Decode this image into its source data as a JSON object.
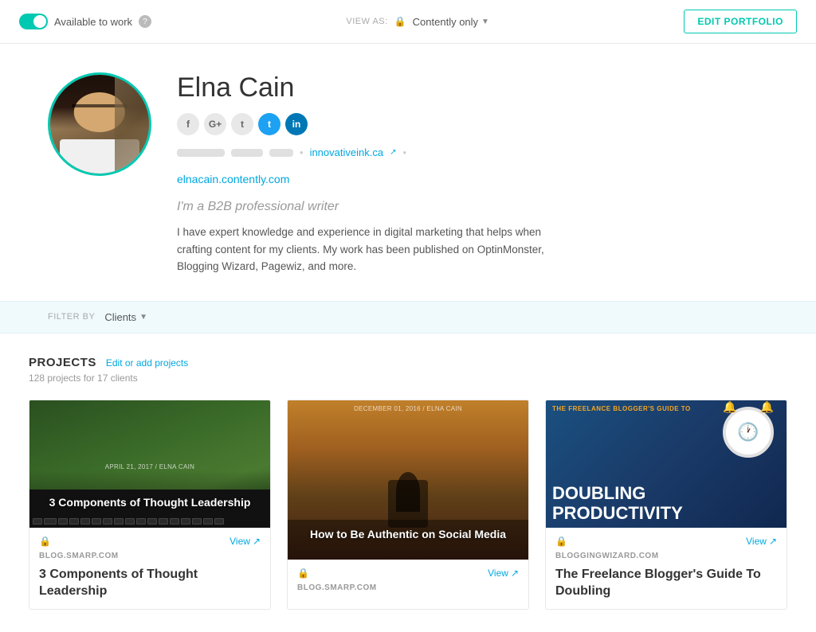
{
  "header": {
    "available_label": "Available to work",
    "view_as_label": "VIEW AS:",
    "view_option": "Contently only",
    "edit_portfolio_label": "EDIT PORTFOLIO"
  },
  "profile": {
    "name": "Elna Cain",
    "tagline": "I'm a B2B professional writer",
    "bio": "I have expert knowledge and experience in digital marketing that helps when crafting content for my clients. My work has been published on OptinMonster, Blogging Wizard, Pagewiz, and more.",
    "website": "innovativeink.ca",
    "portfolio_link": "elnacain.contently.com",
    "social": {
      "facebook": "f",
      "googleplus": "G+",
      "tumblr": "t",
      "twitter": "t",
      "linkedin": "in"
    }
  },
  "filter": {
    "label": "FILTER BY",
    "option": "Clients"
  },
  "projects": {
    "title": "PROJECTS",
    "edit_label": "Edit or add projects",
    "count": "128 projects for 17 clients",
    "items": [
      {
        "source": "BLOG.SMARP.COM",
        "title": "3 Components of Thought Leadership",
        "thumb_text": "3 Components of Thought Leadership",
        "date": "APRIL 21, 2017 / ELNA CAIN",
        "view_label": "View"
      },
      {
        "source": "BLOG.SMARP.COM",
        "title": "How to Be Authentic on Social Media",
        "thumb_text": "How to Be Authentic on Social Media",
        "date": "DECEMBER 01, 2016 / ELNA CAIN",
        "view_label": "View"
      },
      {
        "source": "BLOGGINGWIZARD.COM",
        "title": "The Freelance Blogger's Guide To Doubling",
        "thumb_subtitle": "THE FREELANCE BLOGGER'S GUIDE TO",
        "thumb_big": "DOUBLING PRODUCTIVITY",
        "view_label": "View"
      }
    ]
  }
}
